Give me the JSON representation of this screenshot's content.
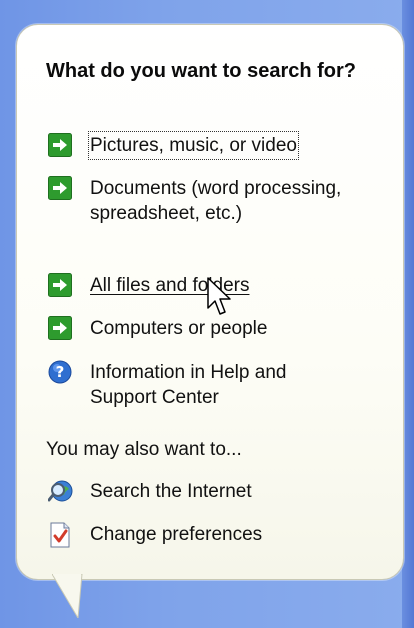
{
  "heading": "What do you want to search for?",
  "items": [
    {
      "label": "Pictures, music, or video",
      "icon": "green-arrow-icon"
    },
    {
      "label": "Documents (word processing, spreadsheet, etc.)",
      "icon": "green-arrow-icon"
    },
    {
      "label": "All files and folders",
      "icon": "green-arrow-icon"
    },
    {
      "label": "Computers or people",
      "icon": "green-arrow-icon"
    },
    {
      "label": "Information in Help and Support Center",
      "icon": "help-icon"
    }
  ],
  "also_heading": "You may also want to...",
  "also_items": [
    {
      "label": "Search the Internet",
      "icon": "internet-search-icon"
    },
    {
      "label": "Change preferences",
      "icon": "preferences-icon"
    }
  ],
  "colors": {
    "pane_blue": "#6f95e6",
    "arrow_green": "#2e9b2e",
    "help_blue": "#2f6fd0"
  }
}
